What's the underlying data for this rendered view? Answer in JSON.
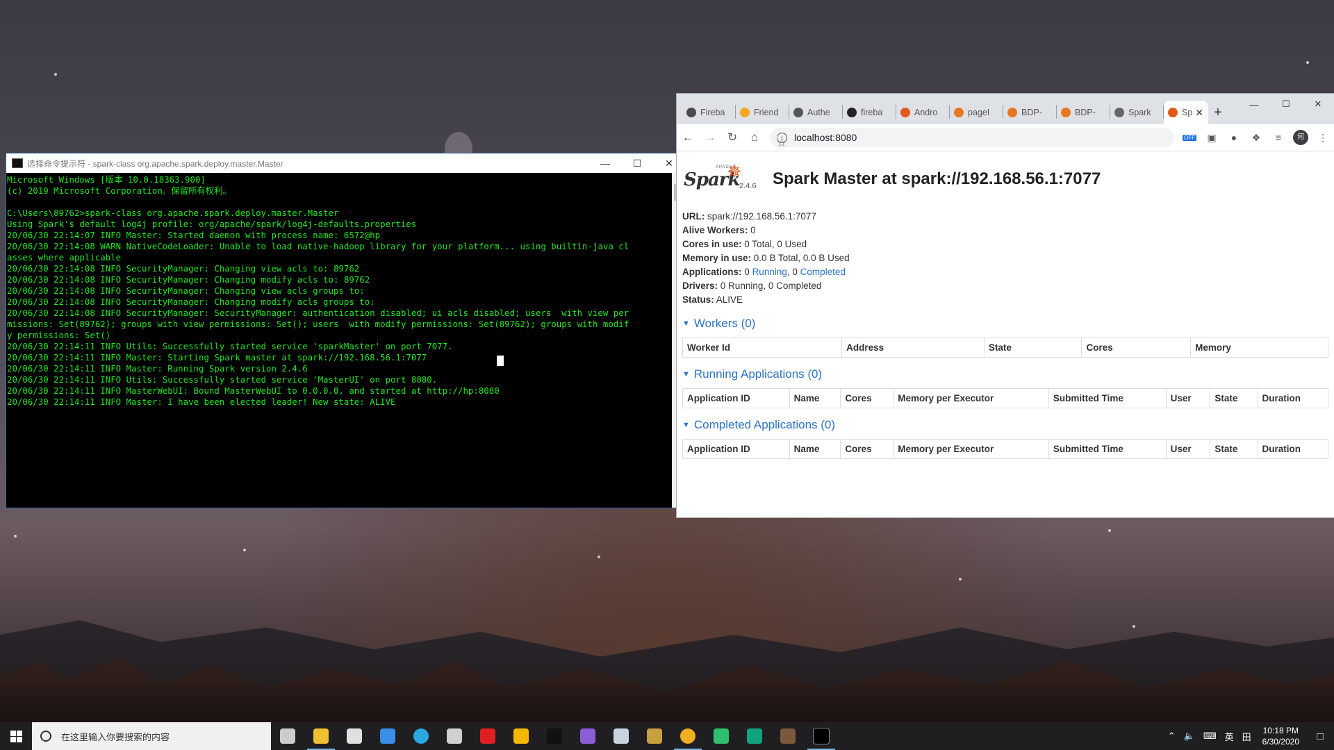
{
  "cmd": {
    "title": "选择命令提示符 - spark-class  org.apache.spark.deploy.master.Master",
    "lines": [
      "Microsoft Windows [版本 10.0.18363.900]",
      "(c) 2019 Microsoft Corporation。保留所有权利。",
      "",
      "C:\\Users\\89762>spark-class org.apache.spark.deploy.master.Master",
      "Using Spark's default log4j profile: org/apache/spark/log4j-defaults.properties",
      "20/06/30 22:14:07 INFO Master: Started daemon with process name: 6572@hp",
      "20/06/30 22:14:08 WARN NativeCodeLoader: Unable to load native-hadoop library for your platform... using builtin-java cl",
      "asses where applicable",
      "20/06/30 22:14:08 INFO SecurityManager: Changing view acls to: 89762",
      "20/06/30 22:14:08 INFO SecurityManager: Changing modify acls to: 89762",
      "20/06/30 22:14:08 INFO SecurityManager: Changing view acls groups to:",
      "20/06/30 22:14:08 INFO SecurityManager: Changing modify acls groups to:",
      "20/06/30 22:14:08 INFO SecurityManager: SecurityManager: authentication disabled; ui acls disabled; users  with view per",
      "missions: Set(89762); groups with view permissions: Set(); users  with modify permissions: Set(89762); groups with modif",
      "y permissions: Set()",
      "20/06/30 22:14:11 INFO Utils: Successfully started service 'sparkMaster' on port 7077.",
      "20/06/30 22:14:11 INFO Master: Starting Spark master at spark://192.168.56.1:7077",
      "20/06/30 22:14:11 INFO Master: Running Spark version 2.4.6",
      "20/06/30 22:14:11 INFO Utils: Successfully started service 'MasterUI' on port 8080.",
      "20/06/30 22:14:11 INFO MasterWebUI: Bound MasterWebUI to 0.0.0.0, and started at http://hp:8080",
      "20/06/30 22:14:11 INFO Master: I have been elected leader! New state: ALIVE"
    ]
  },
  "browser": {
    "tabs": [
      {
        "label": "Fireba",
        "color": "#4a4a4a"
      },
      {
        "label": "Friend",
        "color": "#f5a623"
      },
      {
        "label": "Authe",
        "color": "#555555"
      },
      {
        "label": "fireba",
        "color": "#222222"
      },
      {
        "label": "Andro",
        "color": "#e25a1c"
      },
      {
        "label": "pageI",
        "color": "#e87722"
      },
      {
        "label": "BDP-",
        "color": "#e87722"
      },
      {
        "label": "BDP-",
        "color": "#e87722"
      },
      {
        "label": "Spark",
        "color": "#666666"
      }
    ],
    "active_tab": {
      "label": "Sp",
      "color": "#e25a1c"
    },
    "url": "localhost:8080",
    "ext_off": "OFF",
    "avatar": "何"
  },
  "spark": {
    "logo_word": "Spark",
    "logo_apache": "APACHE",
    "version": "2.4.6",
    "title": "Spark Master at spark://192.168.56.1:7077",
    "url_label": "URL:",
    "url_value": "spark://192.168.56.1:7077",
    "workers_label": "Alive Workers:",
    "workers_value": "0",
    "cores_label": "Cores in use:",
    "cores_value": "0 Total, 0 Used",
    "memory_label": "Memory in use:",
    "memory_value": "0.0 B Total, 0.0 B Used",
    "apps_label": "Applications:",
    "apps_running_count": "0",
    "apps_running_link": "Running",
    "apps_sep": ", 0",
    "apps_completed_link": "Completed",
    "drivers_label": "Drivers:",
    "drivers_value": "0 Running, 0 Completed",
    "status_label": "Status:",
    "status_value": "ALIVE",
    "workers_section": {
      "title": "Workers (0)",
      "columns": [
        "Worker Id",
        "Address",
        "State",
        "Cores",
        "Memory"
      ]
    },
    "running_section": {
      "title": "Running Applications (0)",
      "columns": [
        "Application ID",
        "Name",
        "Cores",
        "Memory per Executor",
        "Submitted Time",
        "User",
        "State",
        "Duration"
      ]
    },
    "completed_section": {
      "title": "Completed Applications (0)",
      "columns": [
        "Application ID",
        "Name",
        "Cores",
        "Memory per Executor",
        "Submitted Time",
        "User",
        "State",
        "Duration"
      ]
    }
  },
  "taskbar": {
    "search_placeholder": "在这里输入你要搜索的内容",
    "apps": [
      {
        "name": "task-view",
        "color": "#cccccc"
      },
      {
        "name": "file-explorer",
        "color": "#f0c030"
      },
      {
        "name": "store",
        "color": "#e0e0e0"
      },
      {
        "name": "mail",
        "color": "#3a8ee6"
      },
      {
        "name": "edge",
        "color": "#2aa8e0"
      },
      {
        "name": "calculator",
        "color": "#d0d0d0"
      },
      {
        "name": "netease-music",
        "color": "#e02020"
      },
      {
        "name": "grammarly",
        "color": "#f5b800"
      },
      {
        "name": "qq",
        "color": "#111111"
      },
      {
        "name": "visual-studio",
        "color": "#8a5fd6"
      },
      {
        "name": "steam",
        "color": "#c8d4e0"
      },
      {
        "name": "league",
        "color": "#c8a040"
      },
      {
        "name": "chrome",
        "color": "#f0b020"
      },
      {
        "name": "app-green",
        "color": "#2fbf71"
      },
      {
        "name": "app-teal",
        "color": "#10a37f"
      },
      {
        "name": "game-icon",
        "color": "#7a5a3a"
      },
      {
        "name": "cmd",
        "color": "#000000"
      }
    ],
    "ime": "英",
    "ime2": "田",
    "time": "10:18 PM",
    "date": "6/30/2020"
  }
}
